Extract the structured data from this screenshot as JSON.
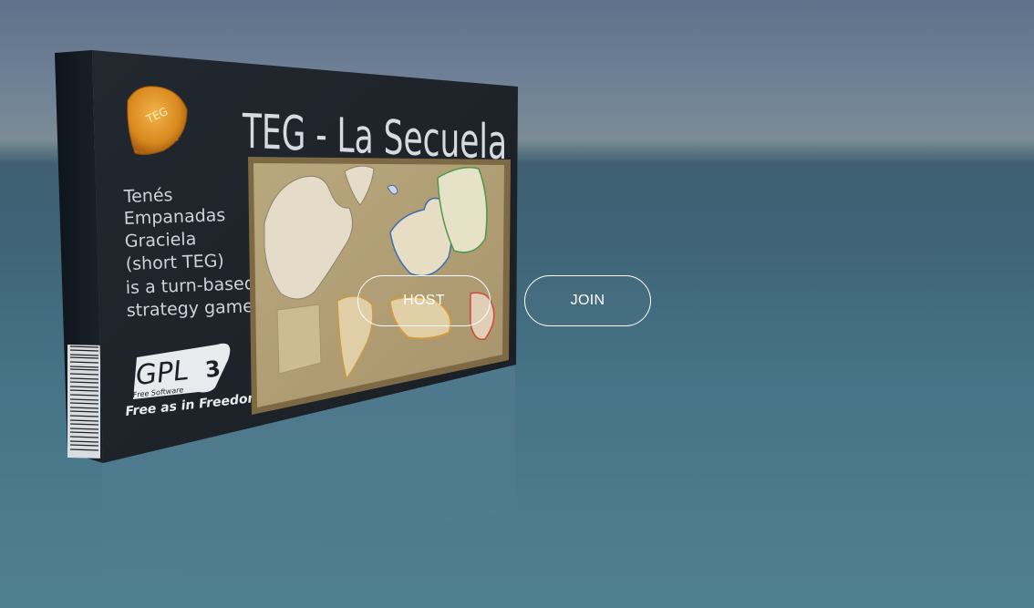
{
  "box": {
    "title": "TEG - La Secuela",
    "emblem_text": "TEG",
    "description_lines": [
      "Tenés",
      "Empanadas",
      "Graciela",
      "(short TEG)",
      "is a turn-based",
      "strategy game"
    ],
    "license_logo": "GPLv3",
    "license_sub": "Free Software",
    "license_motto": "Free as in Freedom",
    "artwork": "world-map-artwork"
  },
  "menu": {
    "host_label": "HOST",
    "join_label": "JOIN"
  },
  "colors": {
    "box_face": "#1c2127",
    "box_side": "#121820",
    "title_text": "#d6dbe2",
    "map_parchment": "#b7a57c",
    "button_border": "#ffffff"
  }
}
